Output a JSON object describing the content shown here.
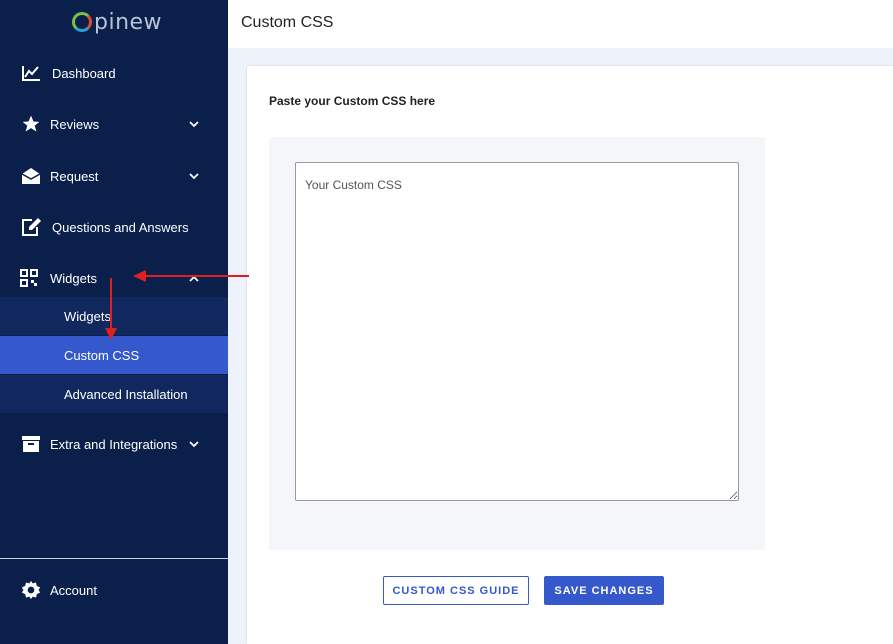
{
  "brand": {
    "logo_text": "pinew",
    "logo_colors": [
      "#7ac143",
      "#e04b2b",
      "#2a9fd6"
    ]
  },
  "colors": {
    "sidebar_bg": "#0b1f4b",
    "submenu_bg": "#10285d",
    "accent": "#3558cd",
    "annotation": "#e02020"
  },
  "sidebar": {
    "items": [
      {
        "label": "Dashboard",
        "icon": "chart-line-icon"
      },
      {
        "label": "Reviews",
        "icon": "star-icon",
        "chevron": "chevron-down-icon"
      },
      {
        "label": "Request",
        "icon": "envelope-open-icon",
        "chevron": "chevron-down-icon"
      },
      {
        "label": "Questions and Answers",
        "icon": "edit-icon"
      },
      {
        "label": "Widgets",
        "icon": "qr-code-icon",
        "chevron": "chevron-up-icon"
      },
      {
        "label": "Extra and Integrations",
        "icon": "archive-icon",
        "chevron": "chevron-down-icon"
      }
    ],
    "widgets_submenu": [
      {
        "label": "Widgets"
      },
      {
        "label": "Custom CSS",
        "active": true
      },
      {
        "label": "Advanced Installation"
      }
    ],
    "account": {
      "label": "Account",
      "icon": "gear-icon"
    }
  },
  "header": {
    "title": "Custom CSS"
  },
  "main": {
    "heading": "Paste your Custom CSS here",
    "editor": {
      "placeholder": "Your Custom CSS",
      "value": ""
    },
    "buttons": {
      "guide": "CUSTOM CSS GUIDE",
      "save": "SAVE CHANGES"
    }
  }
}
